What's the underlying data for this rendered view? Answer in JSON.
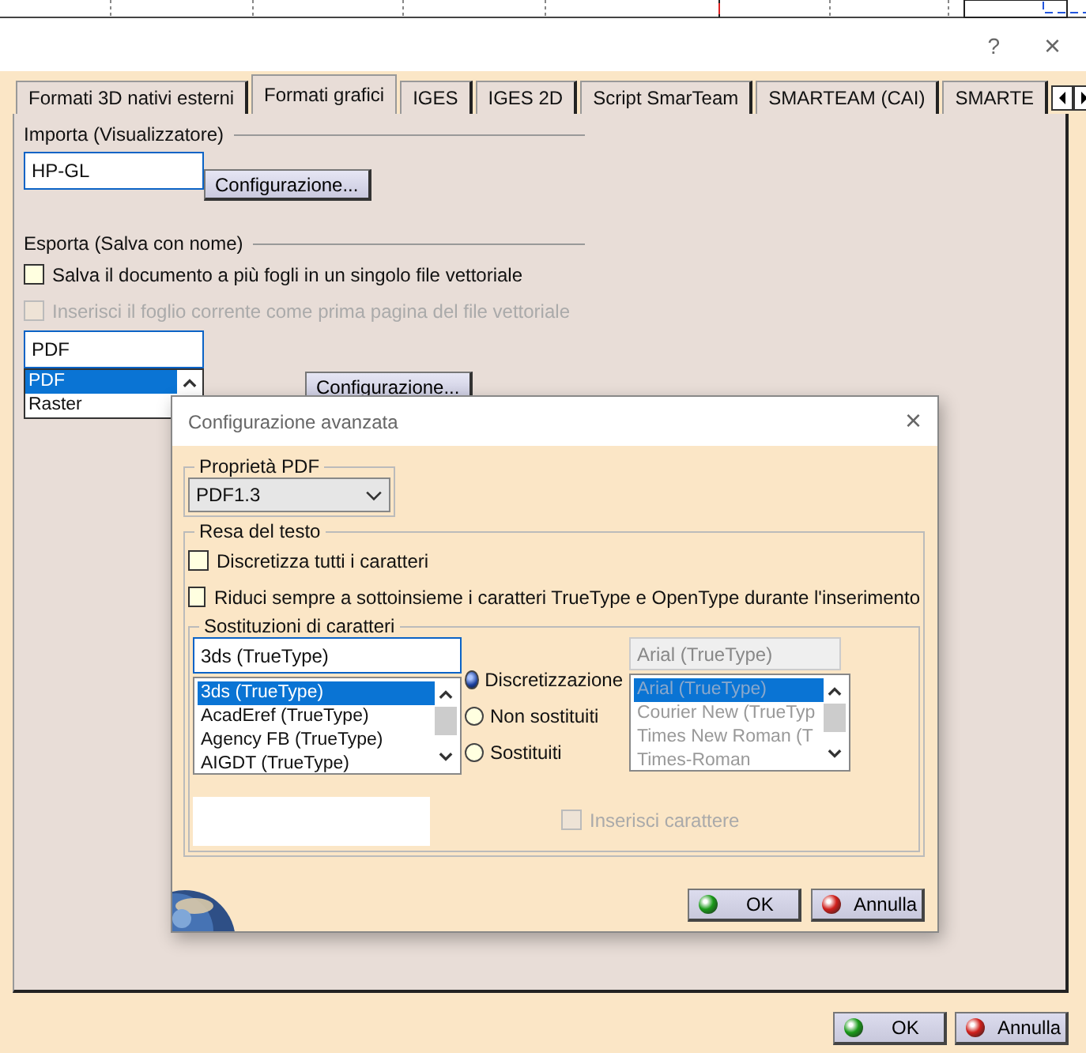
{
  "window": {
    "help": "?",
    "close": "×"
  },
  "tabs": [
    {
      "label": "Formati 3D nativi esterni",
      "selected": false
    },
    {
      "label": "Formati grafici",
      "selected": true
    },
    {
      "label": "IGES",
      "selected": false
    },
    {
      "label": "IGES 2D",
      "selected": false
    },
    {
      "label": "Script SmarTeam",
      "selected": false
    },
    {
      "label": "SMARTEAM (CAI)",
      "selected": false
    },
    {
      "label": "SMARTE",
      "selected": false
    }
  ],
  "import": {
    "title": "Importa (Visualizzatore)",
    "value": "HP-GL",
    "button": "Configurazione..."
  },
  "export": {
    "title": "Esporta (Salva con nome)",
    "options": [
      {
        "label": "Salva il documento a più fogli in un singolo file vettoriale",
        "checked": false,
        "disabled": false
      },
      {
        "label": "Inserisci il foglio corrente come prima pagina del file vettoriale",
        "checked": false,
        "disabled": true
      }
    ],
    "format_value": "PDF",
    "format_list": [
      {
        "label": "PDF",
        "selected": true
      },
      {
        "label": "Raster",
        "selected": false
      }
    ],
    "button": "Configurazione..."
  },
  "dialog": {
    "title": "Configurazione avanzata",
    "close": "×",
    "pdf_group": {
      "title": "Proprietà PDF",
      "version": "PDF1.3"
    },
    "text_group": {
      "title": "Resa del testo",
      "options": [
        {
          "label": "Discretizza tutti i caratteri",
          "checked": false
        },
        {
          "label": "Riduci sempre a sottoinsieme i caratteri TrueType e OpenType durante l'inserimento",
          "checked": false
        }
      ]
    },
    "subst_group": {
      "title": "Sostituzioni di caratteri",
      "font_value": "3ds (TrueType)",
      "fonts": [
        {
          "label": "3ds (TrueType)",
          "selected": true
        },
        {
          "label": "AcadEref (TrueType)",
          "selected": false
        },
        {
          "label": "Agency FB (TrueType)",
          "selected": false
        },
        {
          "label": "AIGDT (TrueType)",
          "selected": false
        }
      ],
      "modes": [
        {
          "label": "Discretizzazione",
          "selected": true
        },
        {
          "label": "Non sostituiti",
          "selected": false
        },
        {
          "label": "Sostituiti",
          "selected": false
        }
      ],
      "target_value": "Arial (TrueType)",
      "targets": [
        {
          "label": "Arial (TrueType)",
          "selected": true
        },
        {
          "label": "Courier New (TrueTyp",
          "selected": false
        },
        {
          "label": "Times New Roman (T",
          "selected": false
        },
        {
          "label": "Times-Roman",
          "selected": false
        }
      ],
      "insert": {
        "label": "Inserisci carattere",
        "checked": false,
        "disabled": true
      }
    },
    "buttons": [
      {
        "label": "OK",
        "kind": "ok"
      },
      {
        "label": "Annulla",
        "kind": "cancel"
      }
    ]
  },
  "buttons": [
    {
      "label": "OK",
      "kind": "ok"
    },
    {
      "label": "Annulla",
      "kind": "cancel"
    }
  ]
}
